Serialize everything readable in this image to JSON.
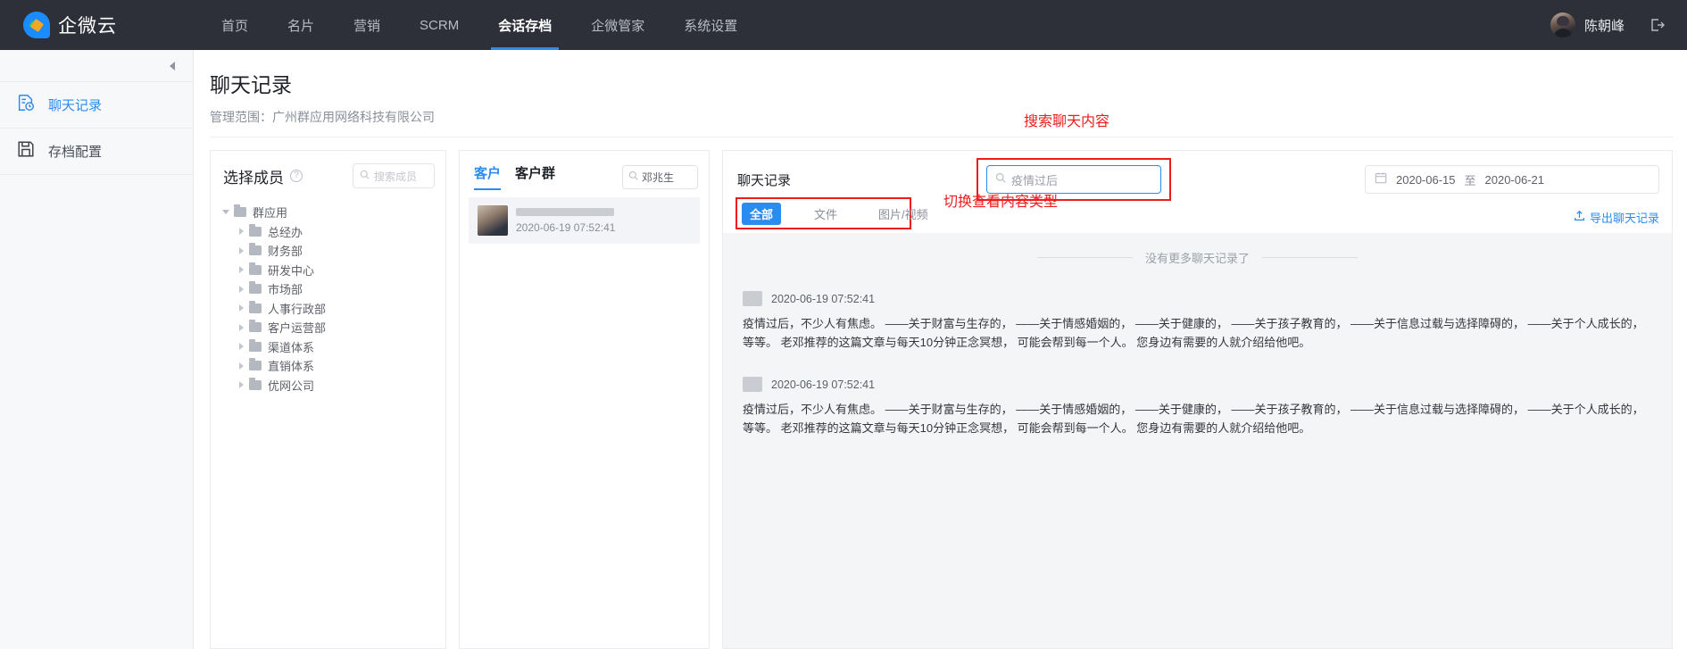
{
  "topnav": {
    "brand": "企微云",
    "items": [
      {
        "label": "首页",
        "active": false
      },
      {
        "label": "名片",
        "active": false
      },
      {
        "label": "营销",
        "active": false
      },
      {
        "label": "SCRM",
        "active": false
      },
      {
        "label": "会话存档",
        "active": true
      },
      {
        "label": "企微管家",
        "active": false
      },
      {
        "label": "系统设置",
        "active": false
      }
    ],
    "username": "陈朝峰",
    "logout_icon": "logout-icon",
    "avatar_icon": "avatar"
  },
  "sidebar": {
    "collapse_icon": "collapse-left-icon",
    "items": [
      {
        "label": "聊天记录",
        "icon": "chat-history-icon",
        "active": true
      },
      {
        "label": "存档配置",
        "icon": "save-disk-icon",
        "active": false
      }
    ]
  },
  "page": {
    "title": "聊天记录",
    "subtitle": "管理范围：广州群应用网络科技有限公司"
  },
  "member_panel": {
    "title": "选择成员",
    "help_icon": "question-mark-icon",
    "search_placeholder": "搜索成员",
    "search_icon": "search-icon",
    "tree": {
      "root": "群应用",
      "children": [
        "总经办",
        "财务部",
        "研发中心",
        "市场部",
        "人事行政部",
        "客户运营部",
        "渠道体系",
        "直销体系",
        "优网公司"
      ]
    }
  },
  "customer_panel": {
    "tabs": [
      {
        "label": "客户",
        "active": true
      },
      {
        "label": "客户群",
        "active": false
      }
    ],
    "search_value": "邓兆生",
    "search_icon": "search-icon",
    "list": [
      {
        "name_redacted": true,
        "time": "2020-06-19 07:52:41",
        "avatar_icon": "avatar"
      }
    ]
  },
  "chat_panel": {
    "title": "聊天记录",
    "search_value": "疫情过后",
    "search_icon": "search-icon",
    "date_start": "2020-06-15",
    "date_sep": "至",
    "date_end": "2020-06-21",
    "calendar_icon": "calendar-icon",
    "filters": [
      {
        "label": "全部",
        "active": true
      },
      {
        "label": "文件",
        "active": false
      },
      {
        "label": "图片/视频",
        "active": false
      }
    ],
    "export_label": "导出聊天记录",
    "export_icon": "upload-icon",
    "no_more_text": "没有更多聊天记录了",
    "messages": [
      {
        "time": "2020-06-19 07:52:41",
        "avatar_icon": "avatar",
        "text": "疫情过后，不少人有焦虑。 ——关于财富与生存的， ——关于情感婚姻的， ——关于健康的， ——关于孩子教育的， ——关于信息过载与选择障碍的， ——关于个人成长的， 等等。 老邓推荐的这篇文章与每天10分钟正念冥想， 可能会帮到每一个人。 您身边有需要的人就介绍给他吧。"
      },
      {
        "time": "2020-06-19 07:52:41",
        "avatar_icon": "avatar",
        "text": "疫情过后，不少人有焦虑。 ——关于财富与生存的， ——关于情感婚姻的， ——关于健康的， ——关于孩子教育的， ——关于信息过载与选择障碍的， ——关于个人成长的， 等等。 老邓推荐的这篇文章与每天10分钟正念冥想， 可能会帮到每一个人。 您身边有需要的人就介绍给他吧。"
      }
    ]
  },
  "annotations": [
    {
      "text": "搜索聊天内容",
      "color": "#ef1c1c"
    },
    {
      "text": "切换查看内容类型",
      "color": "#ef1c1c"
    }
  ]
}
